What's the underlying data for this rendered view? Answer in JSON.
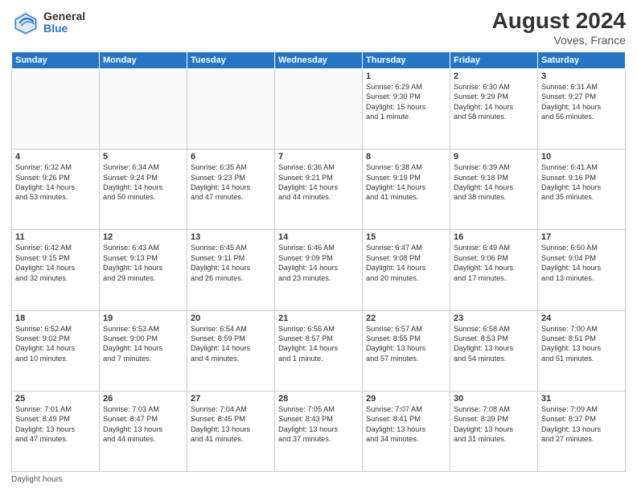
{
  "logo": {
    "general": "General",
    "blue": "Blue"
  },
  "header": {
    "month_year": "August 2024",
    "location": "Voves, France"
  },
  "days_of_week": [
    "Sunday",
    "Monday",
    "Tuesday",
    "Wednesday",
    "Thursday",
    "Friday",
    "Saturday"
  ],
  "weeks": [
    [
      {
        "day": "",
        "info": ""
      },
      {
        "day": "",
        "info": ""
      },
      {
        "day": "",
        "info": ""
      },
      {
        "day": "",
        "info": ""
      },
      {
        "day": "1",
        "info": "Sunrise: 6:29 AM\nSunset: 9:30 PM\nDaylight: 15 hours\nand 1 minute."
      },
      {
        "day": "2",
        "info": "Sunrise: 6:30 AM\nSunset: 9:29 PM\nDaylight: 14 hours\nand 58 minutes."
      },
      {
        "day": "3",
        "info": "Sunrise: 6:31 AM\nSunset: 9:27 PM\nDaylight: 14 hours\nand 56 minutes."
      }
    ],
    [
      {
        "day": "4",
        "info": "Sunrise: 6:32 AM\nSunset: 9:26 PM\nDaylight: 14 hours\nand 53 minutes."
      },
      {
        "day": "5",
        "info": "Sunrise: 6:34 AM\nSunset: 9:24 PM\nDaylight: 14 hours\nand 50 minutes."
      },
      {
        "day": "6",
        "info": "Sunrise: 6:35 AM\nSunset: 9:23 PM\nDaylight: 14 hours\nand 47 minutes."
      },
      {
        "day": "7",
        "info": "Sunrise: 6:36 AM\nSunset: 9:21 PM\nDaylight: 14 hours\nand 44 minutes."
      },
      {
        "day": "8",
        "info": "Sunrise: 6:38 AM\nSunset: 9:19 PM\nDaylight: 14 hours\nand 41 minutes."
      },
      {
        "day": "9",
        "info": "Sunrise: 6:39 AM\nSunset: 9:18 PM\nDaylight: 14 hours\nand 38 minutes."
      },
      {
        "day": "10",
        "info": "Sunrise: 6:41 AM\nSunset: 9:16 PM\nDaylight: 14 hours\nand 35 minutes."
      }
    ],
    [
      {
        "day": "11",
        "info": "Sunrise: 6:42 AM\nSunset: 9:15 PM\nDaylight: 14 hours\nand 32 minutes."
      },
      {
        "day": "12",
        "info": "Sunrise: 6:43 AM\nSunset: 9:13 PM\nDaylight: 14 hours\nand 29 minutes."
      },
      {
        "day": "13",
        "info": "Sunrise: 6:45 AM\nSunset: 9:11 PM\nDaylight: 14 hours\nand 26 minutes."
      },
      {
        "day": "14",
        "info": "Sunrise: 6:46 AM\nSunset: 9:09 PM\nDaylight: 14 hours\nand 23 minutes."
      },
      {
        "day": "15",
        "info": "Sunrise: 6:47 AM\nSunset: 9:08 PM\nDaylight: 14 hours\nand 20 minutes."
      },
      {
        "day": "16",
        "info": "Sunrise: 6:49 AM\nSunset: 9:06 PM\nDaylight: 14 hours\nand 17 minutes."
      },
      {
        "day": "17",
        "info": "Sunrise: 6:50 AM\nSunset: 9:04 PM\nDaylight: 14 hours\nand 13 minutes."
      }
    ],
    [
      {
        "day": "18",
        "info": "Sunrise: 6:52 AM\nSunset: 9:02 PM\nDaylight: 14 hours\nand 10 minutes."
      },
      {
        "day": "19",
        "info": "Sunrise: 6:53 AM\nSunset: 9:00 PM\nDaylight: 14 hours\nand 7 minutes."
      },
      {
        "day": "20",
        "info": "Sunrise: 6:54 AM\nSunset: 8:59 PM\nDaylight: 14 hours\nand 4 minutes."
      },
      {
        "day": "21",
        "info": "Sunrise: 6:56 AM\nSunset: 8:57 PM\nDaylight: 14 hours\nand 1 minute."
      },
      {
        "day": "22",
        "info": "Sunrise: 6:57 AM\nSunset: 8:55 PM\nDaylight: 13 hours\nand 57 minutes."
      },
      {
        "day": "23",
        "info": "Sunrise: 6:58 AM\nSunset: 8:53 PM\nDaylight: 13 hours\nand 54 minutes."
      },
      {
        "day": "24",
        "info": "Sunrise: 7:00 AM\nSunset: 8:51 PM\nDaylight: 13 hours\nand 51 minutes."
      }
    ],
    [
      {
        "day": "25",
        "info": "Sunrise: 7:01 AM\nSunset: 8:49 PM\nDaylight: 13 hours\nand 47 minutes."
      },
      {
        "day": "26",
        "info": "Sunrise: 7:03 AM\nSunset: 8:47 PM\nDaylight: 13 hours\nand 44 minutes."
      },
      {
        "day": "27",
        "info": "Sunrise: 7:04 AM\nSunset: 8:45 PM\nDaylight: 13 hours\nand 41 minutes."
      },
      {
        "day": "28",
        "info": "Sunrise: 7:05 AM\nSunset: 8:43 PM\nDaylight: 13 hours\nand 37 minutes."
      },
      {
        "day": "29",
        "info": "Sunrise: 7:07 AM\nSunset: 8:41 PM\nDaylight: 13 hours\nand 34 minutes."
      },
      {
        "day": "30",
        "info": "Sunrise: 7:08 AM\nSunset: 8:39 PM\nDaylight: 13 hours\nand 31 minutes."
      },
      {
        "day": "31",
        "info": "Sunrise: 7:09 AM\nSunset: 8:37 PM\nDaylight: 13 hours\nand 27 minutes."
      }
    ]
  ],
  "footer": {
    "note": "Daylight hours"
  }
}
